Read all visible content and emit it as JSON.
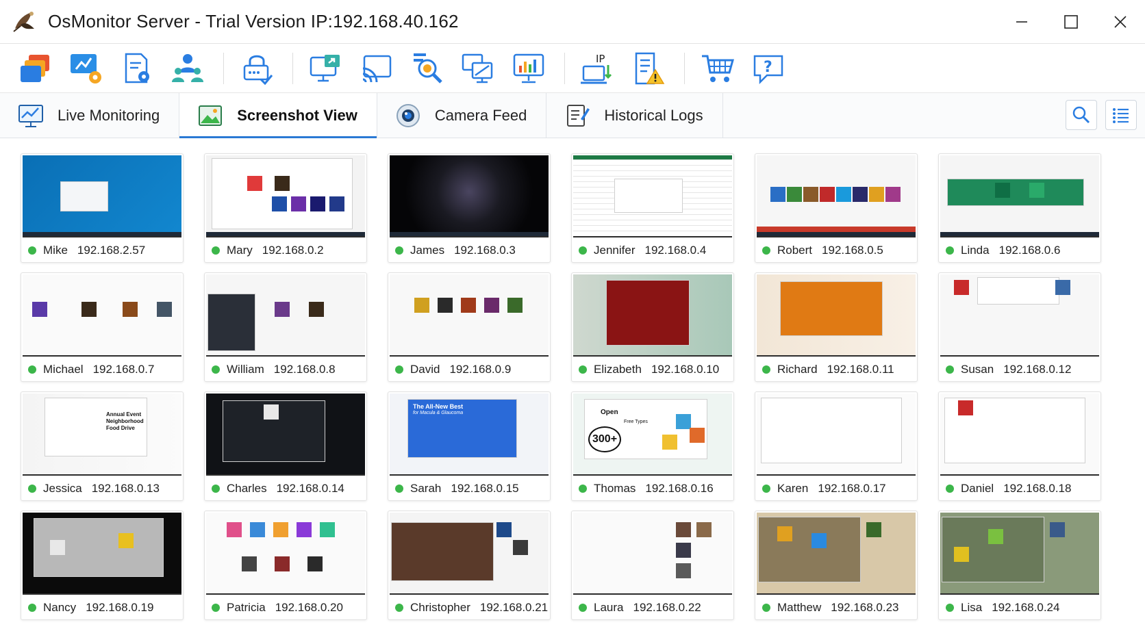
{
  "window": {
    "title": "OsMonitor Server - Trial Version IP:192.168.40.162"
  },
  "toolbar": {
    "icons": [
      "windows-icon",
      "remote-settings-icon",
      "document-settings-icon",
      "users-icon",
      "lock-icon",
      "screen-share-icon",
      "cast-icon",
      "search-inspect-icon",
      "multi-monitor-icon",
      "statistics-icon",
      "ip-config-icon",
      "alert-report-icon",
      "cart-icon",
      "help-icon"
    ]
  },
  "tabs": [
    {
      "label": "Live Monitoring",
      "active": false
    },
    {
      "label": "Screenshot View",
      "active": true
    },
    {
      "label": "Camera Feed",
      "active": false
    },
    {
      "label": "Historical Logs",
      "active": false
    }
  ],
  "clients": [
    {
      "name": "Mike",
      "ip": "192.168.2.57",
      "theme": "desktop-blue"
    },
    {
      "name": "Mary",
      "ip": "192.168.0.2",
      "theme": "browser-store"
    },
    {
      "name": "James",
      "ip": "192.168.0.3",
      "theme": "dark-wallpaper"
    },
    {
      "name": "Jennifer",
      "ip": "192.168.0.4",
      "theme": "spreadsheet"
    },
    {
      "name": "Robert",
      "ip": "192.168.0.5",
      "theme": "app-store"
    },
    {
      "name": "Linda",
      "ip": "192.168.0.6",
      "theme": "green-dashboard"
    },
    {
      "name": "Michael",
      "ip": "192.168.0.7",
      "theme": "browser-banners"
    },
    {
      "name": "William",
      "ip": "192.168.0.8",
      "theme": "dark-panel-banners"
    },
    {
      "name": "David",
      "ip": "192.168.0.9",
      "theme": "game-site"
    },
    {
      "name": "Elizabeth",
      "ip": "192.168.0.10",
      "theme": "card-game"
    },
    {
      "name": "Richard",
      "ip": "192.168.0.11",
      "theme": "slot-game"
    },
    {
      "name": "Susan",
      "ip": "192.168.0.12",
      "theme": "news-site"
    },
    {
      "name": "Jessica",
      "ip": "192.168.0.13",
      "theme": "document-flyer"
    },
    {
      "name": "Charles",
      "ip": "192.168.0.14",
      "theme": "dark-editor"
    },
    {
      "name": "Sarah",
      "ip": "192.168.0.15",
      "theme": "blue-promo"
    },
    {
      "name": "Thomas",
      "ip": "192.168.0.16",
      "theme": "fonts-promo"
    },
    {
      "name": "Karen",
      "ip": "192.168.0.17",
      "theme": "file-explorer"
    },
    {
      "name": "Daniel",
      "ip": "192.168.0.18",
      "theme": "web-page"
    },
    {
      "name": "Nancy",
      "ip": "192.168.0.19",
      "theme": "racing-video"
    },
    {
      "name": "Patricia",
      "ip": "192.168.0.20",
      "theme": "gallery"
    },
    {
      "name": "Christopher",
      "ip": "192.168.0.21",
      "theme": "video-player"
    },
    {
      "name": "Laura",
      "ip": "192.168.0.22",
      "theme": "video-feed"
    },
    {
      "name": "Matthew",
      "ip": "192.168.0.23",
      "theme": "toy-video"
    },
    {
      "name": "Lisa",
      "ip": "192.168.0.24",
      "theme": "robot-video"
    }
  ],
  "thumb_text": {
    "sarah": [
      "The All-New Best",
      "for Macula & Glaucoma"
    ],
    "thomas": [
      "Open",
      "Free Types",
      "300+"
    ],
    "jessica": [
      "Annual Event",
      "Neighborhood",
      "Food Drive"
    ]
  },
  "colors": {
    "online": "#3cb64a",
    "accent": "#2a79d4",
    "taskbar": "#1f2a38"
  }
}
